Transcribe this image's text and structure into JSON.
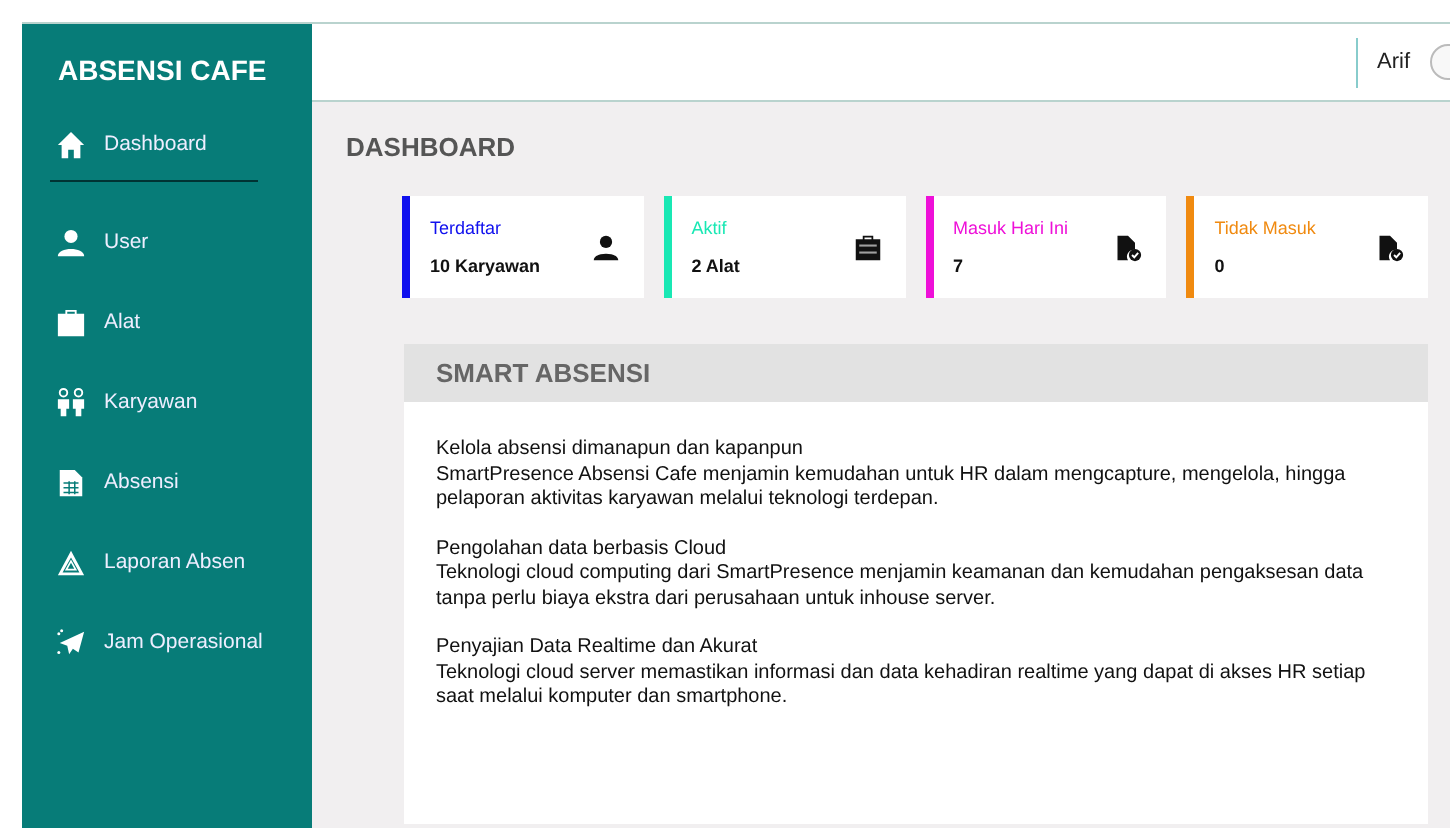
{
  "brand": "ABSENSI CAFE",
  "menu": [
    {
      "label": "Dashboard",
      "kind": "home"
    },
    {
      "label": "User",
      "kind": "user"
    },
    {
      "label": "Alat",
      "kind": "toolbox"
    },
    {
      "label": "Karyawan",
      "kind": "people"
    },
    {
      "label": "Absensi",
      "kind": "sheet"
    },
    {
      "label": "Laporan Absen",
      "kind": "warning"
    },
    {
      "label": "Jam Operasional",
      "kind": "plane"
    }
  ],
  "user": {
    "name": "Arif"
  },
  "page_title": "DASHBOARD",
  "cards": [
    {
      "label": "Terdaftar",
      "value": "10 Karyawan",
      "color": "#1010ee",
      "kind": "user"
    },
    {
      "label": "Aktif",
      "value": "2 Alat",
      "color": "#19e8b4",
      "kind": "toolbox"
    },
    {
      "label": "Masuk Hari Ini",
      "value": "7",
      "color": "#ee10d8",
      "kind": "filecheck"
    },
    {
      "label": "Tidak Masuk",
      "value": "0",
      "color": "#f08a10",
      "kind": "filecheck"
    }
  ],
  "panel": {
    "title": "SMART ABSENSI",
    "sections": [
      {
        "heading": "Kelola absensi dimanapun dan kapanpun",
        "body": "SmartPresence Absensi Cafe menjamin kemudahan untuk HR dalam mengcapture, mengelola, hingga pelaporan aktivitas karyawan melalui teknologi terdepan."
      },
      {
        "heading": "Pengolahan data berbasis Cloud",
        "body": "Teknologi cloud computing dari SmartPresence menjamin keamanan dan kemudahan pengaksesan data tanpa perlu biaya ekstra dari perusahaan untuk inhouse server."
      },
      {
        "heading": "Penyajian Data Realtime dan Akurat",
        "body": "Teknologi cloud server memastikan informasi dan data kehadiran realtime yang dapat di akses HR setiap saat melalui komputer dan smartphone."
      }
    ]
  }
}
